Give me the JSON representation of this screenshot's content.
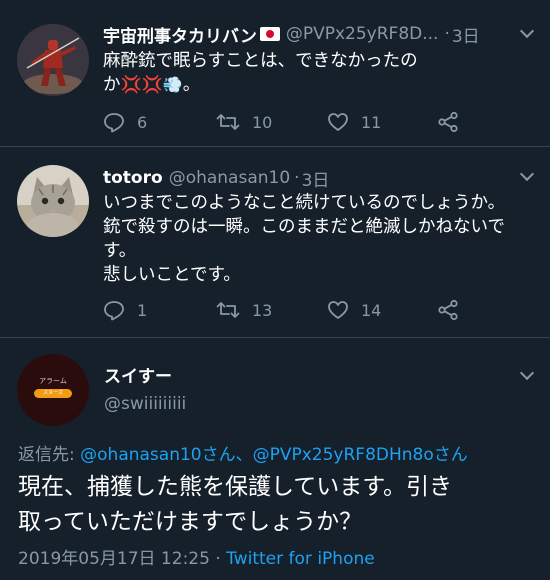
{
  "tweets": [
    {
      "name": "宇宙刑事タカリバン",
      "handle": "@PVPx25yRF8D...",
      "separator": "·",
      "time": "3日",
      "text_line1": "麻酔銃で眠らすことは、できなかったの",
      "text_line2": "か",
      "emoji": [
        "anger-symbol",
        "anger-symbol",
        "dash-symbol"
      ],
      "trailing": "。",
      "replies": "6",
      "retweets": "10",
      "likes": "11"
    },
    {
      "name": "totoro",
      "handle": "@ohanasan10",
      "separator": "·",
      "time": "3日",
      "text_lines": [
        "いつまでこのようなこと続けているのでしょうか。",
        "銃で殺すのは一瞬。このままだと絶滅しかねないで",
        "す。",
        "悲しいことです。"
      ],
      "replies": "1",
      "retweets": "13",
      "likes": "14"
    }
  ],
  "main_tweet": {
    "name": "スイすー",
    "handle": "@swiiiiiiiii",
    "avatar_text_top": "アラーム",
    "avatar_text_button": "スヌーズ",
    "reply_prefix": "返信先: ",
    "reply_targets": "@ohanasan10さん、@PVPx25yRF8DHn8oさん",
    "text_lines": [
      "現在、捕獲した熊を保護しています。引き",
      "取っていただけますでしょうか？"
    ],
    "timestamp": "2019年05月17日 12:25",
    "meta_separator": " · ",
    "client": "Twitter for iPhone"
  },
  "colors": {
    "background": "#15202b",
    "secondary_text": "#8899a6",
    "link": "#1da1f2",
    "divider": "#38444d"
  }
}
